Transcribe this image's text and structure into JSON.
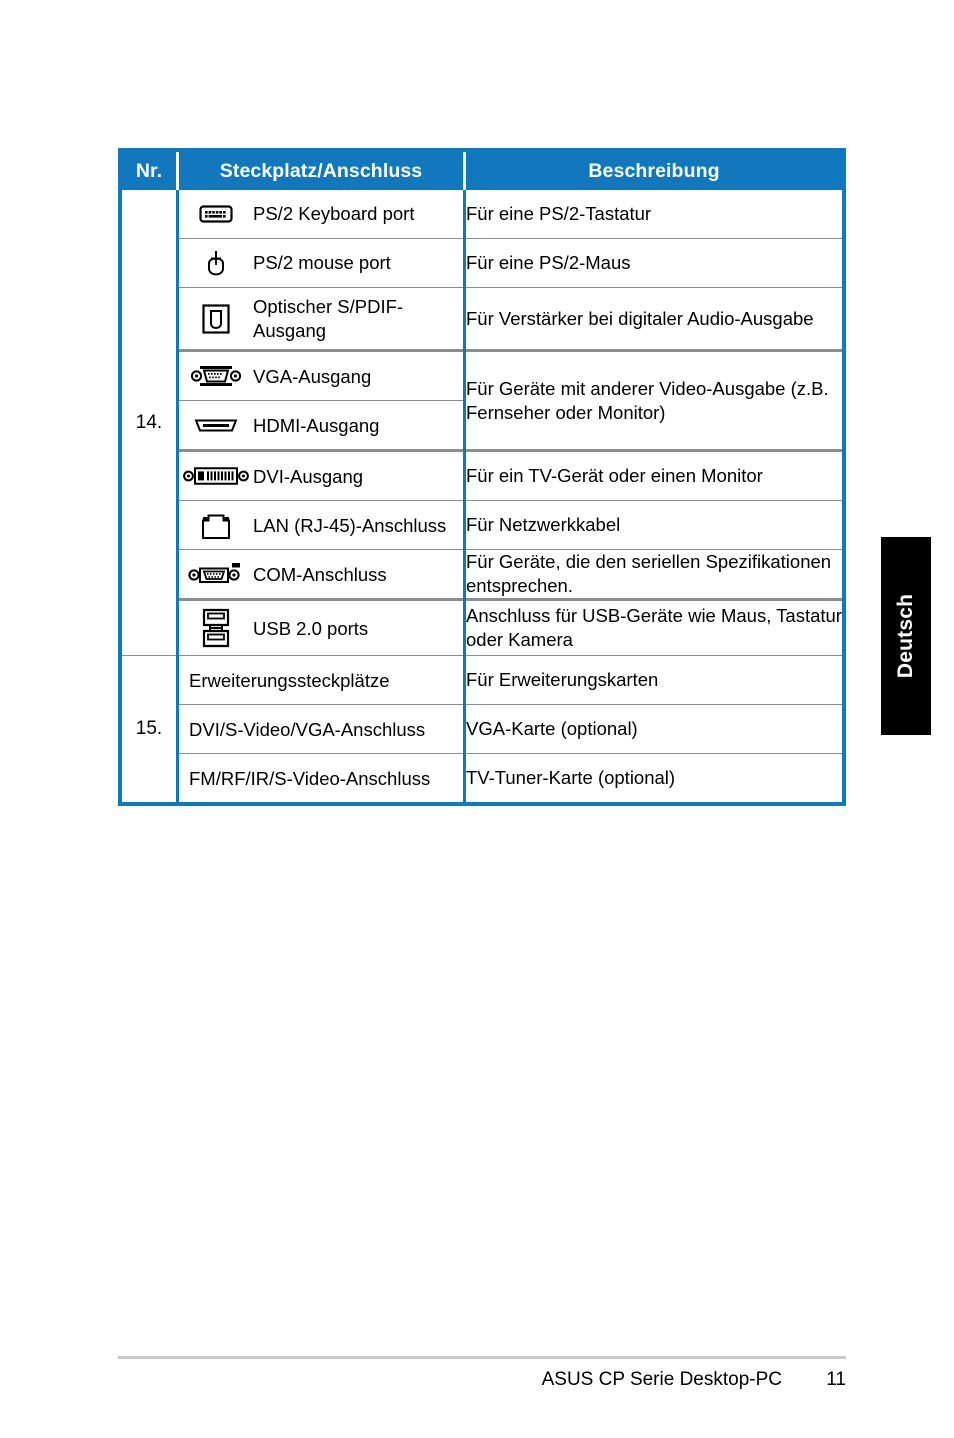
{
  "page": {
    "language_tab": "Deutsch",
    "footer_title": "ASUS CP Serie Desktop-PC",
    "footer_page_number": "11",
    "accent_color": "#1178bd",
    "tab_background": "#000000",
    "rule_color": "#8d8d8d"
  },
  "table": {
    "headers": {
      "nr": "Nr.",
      "slot": "Steckplatz/Anschluss",
      "description": "Beschreibung"
    },
    "groups": [
      {
        "nr": "14.",
        "rows": [
          {
            "icon": "ps2-keyboard-port-icon",
            "label": "PS/2 Keyboard port",
            "description": "Für eine PS/2-Tastatur"
          },
          {
            "icon": "ps2-mouse-port-icon",
            "label": "PS/2 mouse port",
            "description": "Für eine PS/2-Maus"
          },
          {
            "icon": "optical-spdif-out-icon",
            "label": "Optischer S/PDIF-Ausgang",
            "description": "Für Verstärker bei digitaler Audio-Ausgabe"
          },
          {
            "icon": "vga-port-icon",
            "label": "VGA-Ausgang",
            "description": "Für Geräte mit anderer Video-Ausgabe (z.B. Fernseher oder Monitor)"
          },
          {
            "icon": "hdmi-port-icon",
            "label": "HDMI-Ausgang",
            "description": ""
          },
          {
            "icon": "dvi-port-icon",
            "label": "DVI-Ausgang",
            "description": "Für ein TV-Gerät oder einen Monitor"
          },
          {
            "icon": "lan-rj45-port-icon",
            "label": "LAN (RJ-45)-Anschluss",
            "description": "Für Netzwerkkabel"
          },
          {
            "icon": "com-serial-port-icon",
            "label": "COM-Anschluss",
            "description": "Für Geräte, die den seriellen Spezifikationen entsprechen."
          },
          {
            "icon": "usb-port-icon",
            "label": "USB 2.0 ports",
            "description": "Anschluss für USB-Geräte wie Maus, Tastatur oder Kamera"
          }
        ]
      },
      {
        "nr": "15.",
        "rows": [
          {
            "icon": "",
            "label": "Erweiterungssteckplätze",
            "description": "Für Erweiterungskarten"
          },
          {
            "icon": "",
            "label": "DVI/S-Video/VGA-Anschluss",
            "description": "VGA-Karte (optional)"
          },
          {
            "icon": "",
            "label": "FM/RF/IR/S-Video-Anschluss",
            "description": "TV-Tuner-Karte (optional)"
          }
        ]
      }
    ]
  }
}
